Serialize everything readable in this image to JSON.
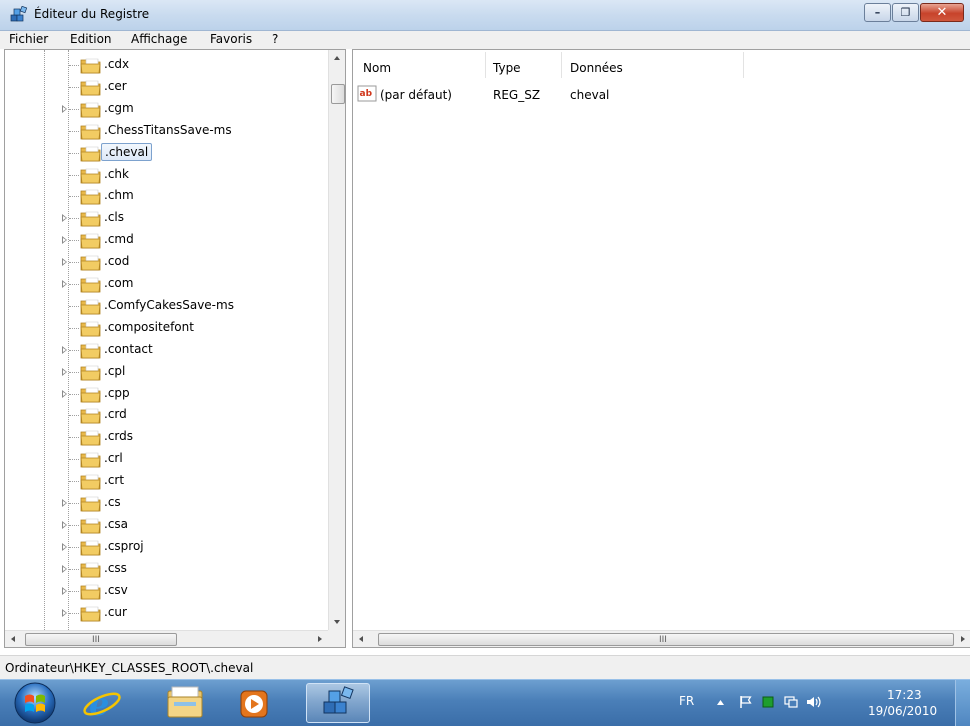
{
  "window": {
    "title": "Éditeur du Registre",
    "controls": {
      "minimize": "–",
      "maximize": "❐",
      "close": "✕"
    }
  },
  "menu": [
    "Fichier",
    "Edition",
    "Affichage",
    "Favoris",
    "?"
  ],
  "tree": {
    "items": [
      {
        "label": ".cdx",
        "expandable": false
      },
      {
        "label": ".cer",
        "expandable": false
      },
      {
        "label": ".cgm",
        "expandable": true
      },
      {
        "label": ".ChessTitansSave-ms",
        "expandable": false
      },
      {
        "label": ".cheval",
        "expandable": false,
        "selected": true
      },
      {
        "label": ".chk",
        "expandable": false
      },
      {
        "label": ".chm",
        "expandable": false
      },
      {
        "label": ".cls",
        "expandable": true
      },
      {
        "label": ".cmd",
        "expandable": true
      },
      {
        "label": ".cod",
        "expandable": true
      },
      {
        "label": ".com",
        "expandable": true
      },
      {
        "label": ".ComfyCakesSave-ms",
        "expandable": false
      },
      {
        "label": ".compositefont",
        "expandable": false
      },
      {
        "label": ".contact",
        "expandable": true
      },
      {
        "label": ".cpl",
        "expandable": true
      },
      {
        "label": ".cpp",
        "expandable": true
      },
      {
        "label": ".crd",
        "expandable": false
      },
      {
        "label": ".crds",
        "expandable": false
      },
      {
        "label": ".crl",
        "expandable": false
      },
      {
        "label": ".crt",
        "expandable": false
      },
      {
        "label": ".cs",
        "expandable": true
      },
      {
        "label": ".csa",
        "expandable": true
      },
      {
        "label": ".csproj",
        "expandable": true
      },
      {
        "label": ".css",
        "expandable": true
      },
      {
        "label": ".csv",
        "expandable": true
      },
      {
        "label": ".cur",
        "expandable": true
      }
    ],
    "scroll_grip": "III"
  },
  "values": {
    "columns": {
      "name": "Nom",
      "type": "Type",
      "data": "Données"
    },
    "rows": [
      {
        "name": "(par défaut)",
        "type": "REG_SZ",
        "data": "cheval",
        "icon": "string-value-icon"
      }
    ],
    "scroll_grip": "III"
  },
  "status": {
    "path": "Ordinateur\\HKEY_CLASSES_ROOT\\.cheval"
  },
  "taskbar": {
    "apps": [
      "internet-explorer-icon",
      "file-explorer-icon",
      "media-player-icon",
      "registry-editor-icon"
    ],
    "language": "FR",
    "time": "17:23",
    "date": "19/06/2010"
  },
  "colors": {
    "folder": "#e8b84a",
    "selection_border": "#7da2ce",
    "taskbar": "#4a7fb8"
  }
}
